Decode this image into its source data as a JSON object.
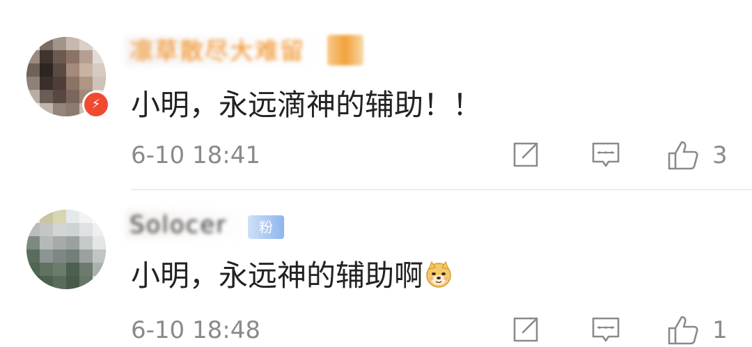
{
  "comments": [
    {
      "username": "凛草散尽大难留",
      "content": "小明，永远滴神的辅助！！",
      "time": "6-10 18:41",
      "likes": "3",
      "avatar_badge": "⚡",
      "icons": {
        "share": "share-edit-icon",
        "reply": "comment-icon",
        "like": "thumbs-up-icon"
      }
    },
    {
      "username": "Solocer",
      "tag": "粉",
      "content": "小明，永远神的辅助啊",
      "emoji": "doge-emoji",
      "time": "6-10 18:48",
      "likes": "1",
      "icons": {
        "share": "share-edit-icon",
        "reply": "comment-icon",
        "like": "thumbs-up-icon"
      }
    }
  ],
  "colors": {
    "username_vip": "#f08a1c",
    "text": "#222222",
    "meta": "#8a8a8a",
    "divider": "#ececec",
    "badge": "#f04b31"
  }
}
